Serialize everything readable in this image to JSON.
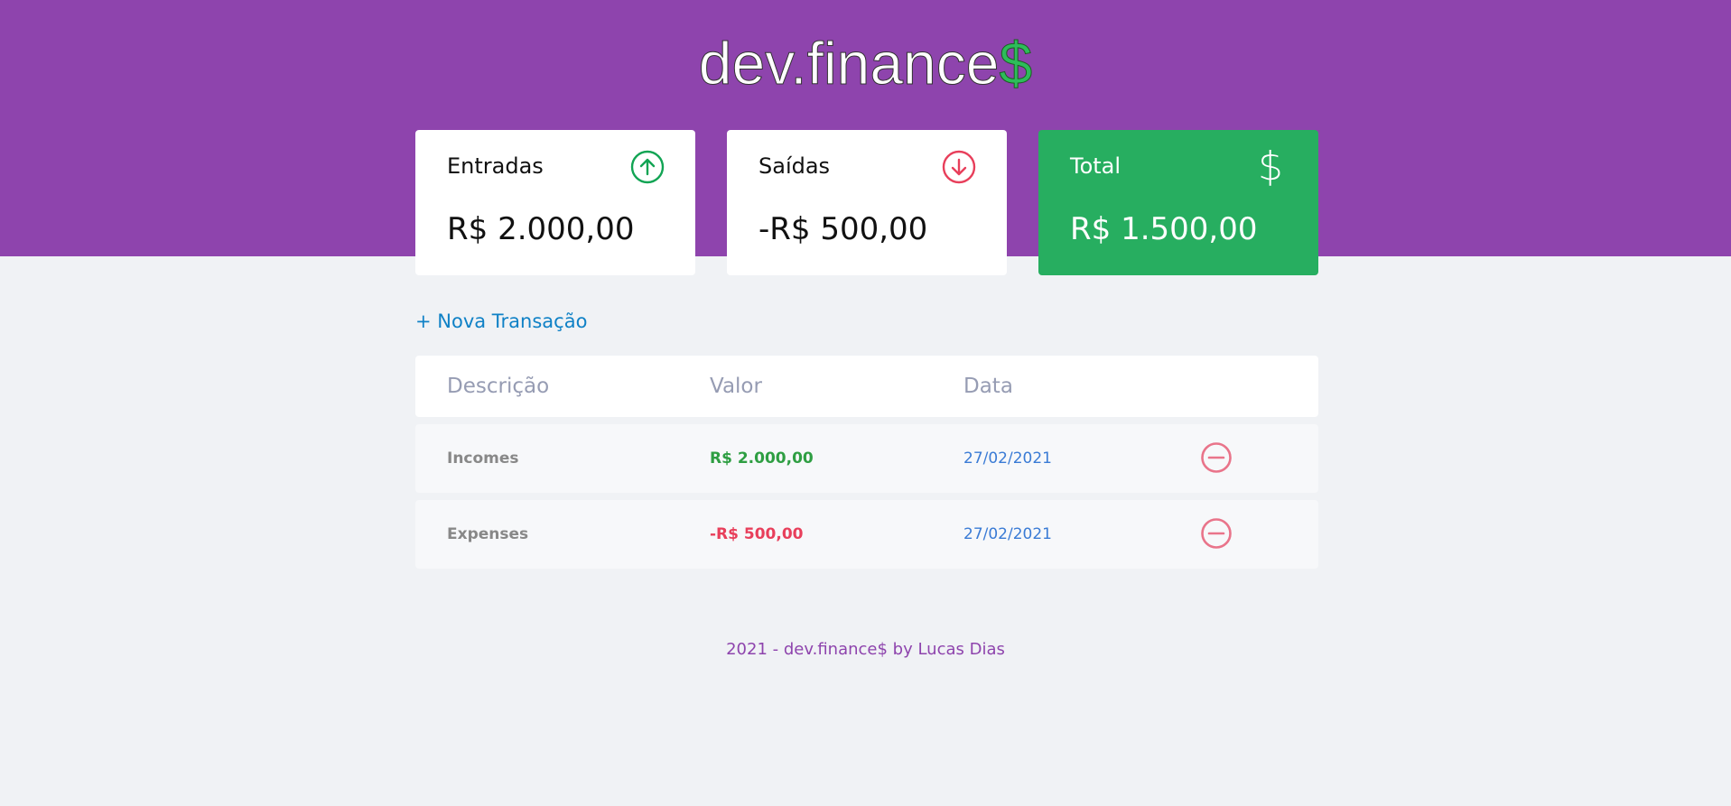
{
  "header": {
    "logo_text": "dev.finance",
    "logo_symbol": "$",
    "colors": {
      "background": "#8e44ad",
      "symbol": "#2dbc5a"
    }
  },
  "cards": {
    "incomes": {
      "label": "Entradas",
      "value": "R$ 2.000,00",
      "icon": "arrow-up-circle-icon",
      "icon_color": "#12a454"
    },
    "expenses": {
      "label": "Saídas",
      "value": "-R$ 500,00",
      "icon": "arrow-down-circle-icon",
      "icon_color": "#e83f5b"
    },
    "total": {
      "label": "Total",
      "value": "R$ 1.500,00",
      "icon": "dollar-icon",
      "icon_glyph": "$",
      "background": "#27ae60"
    }
  },
  "new_transaction": {
    "label": "+ Nova Transação"
  },
  "table": {
    "headers": [
      "Descrição",
      "Valor",
      "Data"
    ],
    "rows": [
      {
        "description": "Incomes",
        "amount": "R$ 2.000,00",
        "type": "income",
        "date": "27/02/2021"
      },
      {
        "description": "Expenses",
        "amount": "-R$ 500,00",
        "type": "expense",
        "date": "27/02/2021"
      }
    ]
  },
  "footer": {
    "text": "2021 - dev.finance$ by Lucas Dias"
  }
}
